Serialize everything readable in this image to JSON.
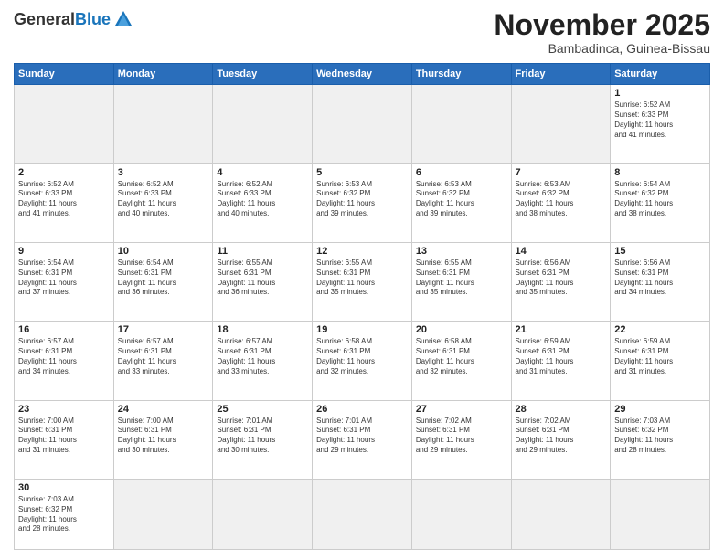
{
  "header": {
    "logo_general": "General",
    "logo_blue": "Blue",
    "month_title": "November 2025",
    "location": "Bambadinca, Guinea-Bissau"
  },
  "weekdays": [
    "Sunday",
    "Monday",
    "Tuesday",
    "Wednesday",
    "Thursday",
    "Friday",
    "Saturday"
  ],
  "days": [
    {
      "num": "",
      "info": ""
    },
    {
      "num": "",
      "info": ""
    },
    {
      "num": "",
      "info": ""
    },
    {
      "num": "",
      "info": ""
    },
    {
      "num": "",
      "info": ""
    },
    {
      "num": "",
      "info": ""
    },
    {
      "num": "1",
      "info": "Sunrise: 6:52 AM\nSunset: 6:33 PM\nDaylight: 11 hours\nand 41 minutes."
    },
    {
      "num": "2",
      "info": "Sunrise: 6:52 AM\nSunset: 6:33 PM\nDaylight: 11 hours\nand 41 minutes."
    },
    {
      "num": "3",
      "info": "Sunrise: 6:52 AM\nSunset: 6:33 PM\nDaylight: 11 hours\nand 40 minutes."
    },
    {
      "num": "4",
      "info": "Sunrise: 6:52 AM\nSunset: 6:33 PM\nDaylight: 11 hours\nand 40 minutes."
    },
    {
      "num": "5",
      "info": "Sunrise: 6:53 AM\nSunset: 6:32 PM\nDaylight: 11 hours\nand 39 minutes."
    },
    {
      "num": "6",
      "info": "Sunrise: 6:53 AM\nSunset: 6:32 PM\nDaylight: 11 hours\nand 39 minutes."
    },
    {
      "num": "7",
      "info": "Sunrise: 6:53 AM\nSunset: 6:32 PM\nDaylight: 11 hours\nand 38 minutes."
    },
    {
      "num": "8",
      "info": "Sunrise: 6:54 AM\nSunset: 6:32 PM\nDaylight: 11 hours\nand 38 minutes."
    },
    {
      "num": "9",
      "info": "Sunrise: 6:54 AM\nSunset: 6:31 PM\nDaylight: 11 hours\nand 37 minutes."
    },
    {
      "num": "10",
      "info": "Sunrise: 6:54 AM\nSunset: 6:31 PM\nDaylight: 11 hours\nand 36 minutes."
    },
    {
      "num": "11",
      "info": "Sunrise: 6:55 AM\nSunset: 6:31 PM\nDaylight: 11 hours\nand 36 minutes."
    },
    {
      "num": "12",
      "info": "Sunrise: 6:55 AM\nSunset: 6:31 PM\nDaylight: 11 hours\nand 35 minutes."
    },
    {
      "num": "13",
      "info": "Sunrise: 6:55 AM\nSunset: 6:31 PM\nDaylight: 11 hours\nand 35 minutes."
    },
    {
      "num": "14",
      "info": "Sunrise: 6:56 AM\nSunset: 6:31 PM\nDaylight: 11 hours\nand 35 minutes."
    },
    {
      "num": "15",
      "info": "Sunrise: 6:56 AM\nSunset: 6:31 PM\nDaylight: 11 hours\nand 34 minutes."
    },
    {
      "num": "16",
      "info": "Sunrise: 6:57 AM\nSunset: 6:31 PM\nDaylight: 11 hours\nand 34 minutes."
    },
    {
      "num": "17",
      "info": "Sunrise: 6:57 AM\nSunset: 6:31 PM\nDaylight: 11 hours\nand 33 minutes."
    },
    {
      "num": "18",
      "info": "Sunrise: 6:57 AM\nSunset: 6:31 PM\nDaylight: 11 hours\nand 33 minutes."
    },
    {
      "num": "19",
      "info": "Sunrise: 6:58 AM\nSunset: 6:31 PM\nDaylight: 11 hours\nand 32 minutes."
    },
    {
      "num": "20",
      "info": "Sunrise: 6:58 AM\nSunset: 6:31 PM\nDaylight: 11 hours\nand 32 minutes."
    },
    {
      "num": "21",
      "info": "Sunrise: 6:59 AM\nSunset: 6:31 PM\nDaylight: 11 hours\nand 31 minutes."
    },
    {
      "num": "22",
      "info": "Sunrise: 6:59 AM\nSunset: 6:31 PM\nDaylight: 11 hours\nand 31 minutes."
    },
    {
      "num": "23",
      "info": "Sunrise: 7:00 AM\nSunset: 6:31 PM\nDaylight: 11 hours\nand 31 minutes."
    },
    {
      "num": "24",
      "info": "Sunrise: 7:00 AM\nSunset: 6:31 PM\nDaylight: 11 hours\nand 30 minutes."
    },
    {
      "num": "25",
      "info": "Sunrise: 7:01 AM\nSunset: 6:31 PM\nDaylight: 11 hours\nand 30 minutes."
    },
    {
      "num": "26",
      "info": "Sunrise: 7:01 AM\nSunset: 6:31 PM\nDaylight: 11 hours\nand 29 minutes."
    },
    {
      "num": "27",
      "info": "Sunrise: 7:02 AM\nSunset: 6:31 PM\nDaylight: 11 hours\nand 29 minutes."
    },
    {
      "num": "28",
      "info": "Sunrise: 7:02 AM\nSunset: 6:31 PM\nDaylight: 11 hours\nand 29 minutes."
    },
    {
      "num": "29",
      "info": "Sunrise: 7:03 AM\nSunset: 6:32 PM\nDaylight: 11 hours\nand 28 minutes."
    },
    {
      "num": "30",
      "info": "Sunrise: 7:03 AM\nSunset: 6:32 PM\nDaylight: 11 hours\nand 28 minutes."
    }
  ]
}
